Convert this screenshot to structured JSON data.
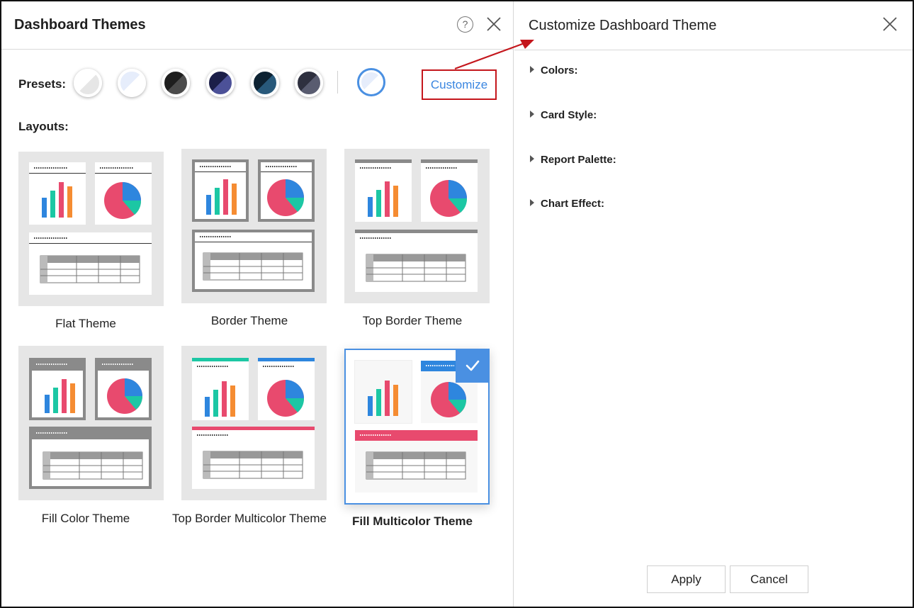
{
  "left_dialog": {
    "title": "Dashboard Themes",
    "help_symbol": "?",
    "presets_label": "Presets:",
    "customize_label": "Customize",
    "layouts_label": "Layouts:",
    "presets": [
      {
        "name": "light-gray",
        "a": "#e9e9e9",
        "b": "#ffffff"
      },
      {
        "name": "light-blue",
        "a": "#e8eefb",
        "b": "#ffffff"
      },
      {
        "name": "black",
        "a": "#1f1f1f",
        "b": "#4a4a4a"
      },
      {
        "name": "navy",
        "a": "#1c1f4a",
        "b": "#4a4f96"
      },
      {
        "name": "dark-teal",
        "a": "#0e2433",
        "b": "#27597a"
      },
      {
        "name": "slate",
        "a": "#2f3140",
        "b": "#575a6e"
      },
      {
        "name": "custom-selected",
        "a": "#e8eefb",
        "b": "#ffffff"
      }
    ],
    "themes": [
      {
        "label": "Flat Theme"
      },
      {
        "label": "Border Theme"
      },
      {
        "label": "Top Border Theme"
      },
      {
        "label": "Fill Color Theme"
      },
      {
        "label": "Top Border Multicolor Theme"
      },
      {
        "label": "Fill Multicolor Theme",
        "selected": true
      }
    ]
  },
  "right_panel": {
    "title": "Customize Dashboard Theme",
    "sections": [
      "Colors:",
      "Card Style:",
      "Report Palette:",
      "Chart Effect:"
    ],
    "apply_label": "Apply",
    "cancel_label": "Cancel"
  },
  "colors": {
    "accent": "#4a90e2",
    "highlight_border": "#c4161c",
    "bar_blue": "#2e86de",
    "bar_teal": "#1cc7a4",
    "bar_pink": "#e84a6e",
    "bar_orange": "#f58c32"
  }
}
